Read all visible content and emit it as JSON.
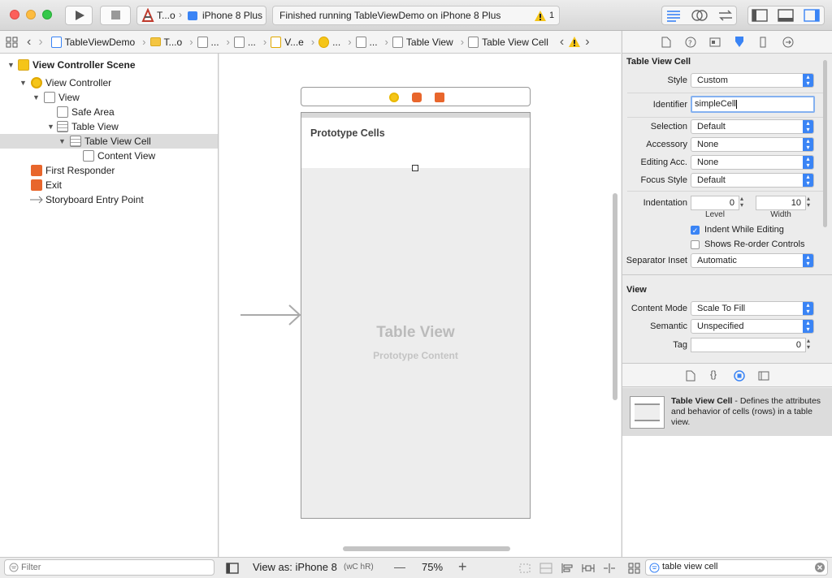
{
  "toolbar": {
    "scheme_project": "T...o",
    "scheme_device": "iPhone 8 Plus",
    "status_text": "Finished running TableViewDemo on iPhone 8 Plus",
    "warning_count": "1"
  },
  "jumpbar": {
    "items": [
      "TableViewDemo",
      "T...o",
      "...",
      "...",
      "V...e",
      "...",
      "...",
      "Table View",
      "Table View Cell"
    ]
  },
  "navigator": {
    "scene": "View Controller Scene",
    "view_controller": "View Controller",
    "view": "View",
    "safe_area": "Safe Area",
    "table_view": "Table View",
    "table_view_cell": "Table View Cell",
    "content_view": "Content View",
    "first_responder": "First Responder",
    "exit": "Exit",
    "entry_point": "Storyboard Entry Point",
    "filter_placeholder": "Filter"
  },
  "canvas": {
    "prototype_cells": "Prototype Cells",
    "table_view_title": "Table View",
    "table_view_subtitle": "Prototype Content",
    "view_as": "View as: iPhone 8",
    "size_class": "(wC hR)",
    "zoom_minus": "—",
    "zoom": "75%",
    "zoom_plus": "+"
  },
  "inspector": {
    "section_cell": "Table View Cell",
    "style_label": "Style",
    "style_value": "Custom",
    "identifier_label": "Identifier",
    "identifier_value": "simpleCell",
    "selection_label": "Selection",
    "selection_value": "Default",
    "accessory_label": "Accessory",
    "accessory_value": "None",
    "editing_acc_label": "Editing Acc.",
    "editing_acc_value": "None",
    "focus_style_label": "Focus Style",
    "focus_style_value": "Default",
    "indentation_label": "Indentation",
    "level_value": "0",
    "width_value": "10",
    "level_label": "Level",
    "width_label": "Width",
    "indent_while_editing": "Indent While Editing",
    "reorder_controls": "Shows Re-order Controls",
    "separator_inset_label": "Separator Inset",
    "separator_inset_value": "Automatic",
    "section_view": "View",
    "content_mode_label": "Content Mode",
    "content_mode_value": "Scale To Fill",
    "semantic_label": "Semantic",
    "semantic_value": "Unspecified",
    "tag_label": "Tag",
    "tag_value": "0"
  },
  "library": {
    "title": "Table View Cell",
    "description": " - Defines the attributes and behavior of cells (rows) in a table view.",
    "search_value": "table view cell"
  },
  "colors": {
    "accent": "#3a84f5",
    "warning": "#f5c518",
    "vc_icon": "#f5c518",
    "responder_icon": "#e8662c"
  }
}
